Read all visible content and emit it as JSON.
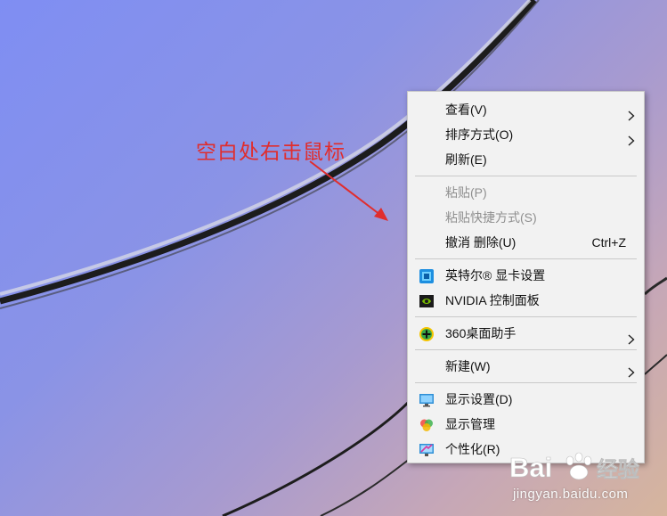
{
  "annotation": {
    "text": "空白处右击鼠标"
  },
  "context_menu": {
    "groups": [
      [
        {
          "label": "查看(V)",
          "submenu": true
        },
        {
          "label": "排序方式(O)",
          "submenu": true
        },
        {
          "label": "刷新(E)"
        }
      ],
      [
        {
          "label": "粘贴(P)",
          "disabled": true
        },
        {
          "label": "粘贴快捷方式(S)",
          "disabled": true
        },
        {
          "label": "撤消 删除(U)",
          "shortcut": "Ctrl+Z"
        }
      ],
      [
        {
          "label": "英特尔® 显卡设置",
          "icon": "intel-graphics-icon"
        },
        {
          "label": "NVIDIA 控制面板",
          "icon": "nvidia-icon"
        }
      ],
      [
        {
          "label": "360桌面助手",
          "icon": "360-desktop-icon",
          "submenu": true
        }
      ],
      [
        {
          "label": "新建(W)",
          "submenu": true
        }
      ],
      [
        {
          "label": "显示设置(D)",
          "icon": "display-settings-icon"
        },
        {
          "label": "显示管理",
          "icon": "display-manager-icon"
        },
        {
          "label": "个性化(R)",
          "icon": "personalize-icon"
        }
      ]
    ]
  },
  "watermark": {
    "logo_text": "Bai 经验",
    "url": "jingyan.baidu.com"
  },
  "colors": {
    "annotation": "#e02d2d",
    "menu_bg": "#f2f2f2",
    "disabled_text": "#8f8f8f"
  }
}
